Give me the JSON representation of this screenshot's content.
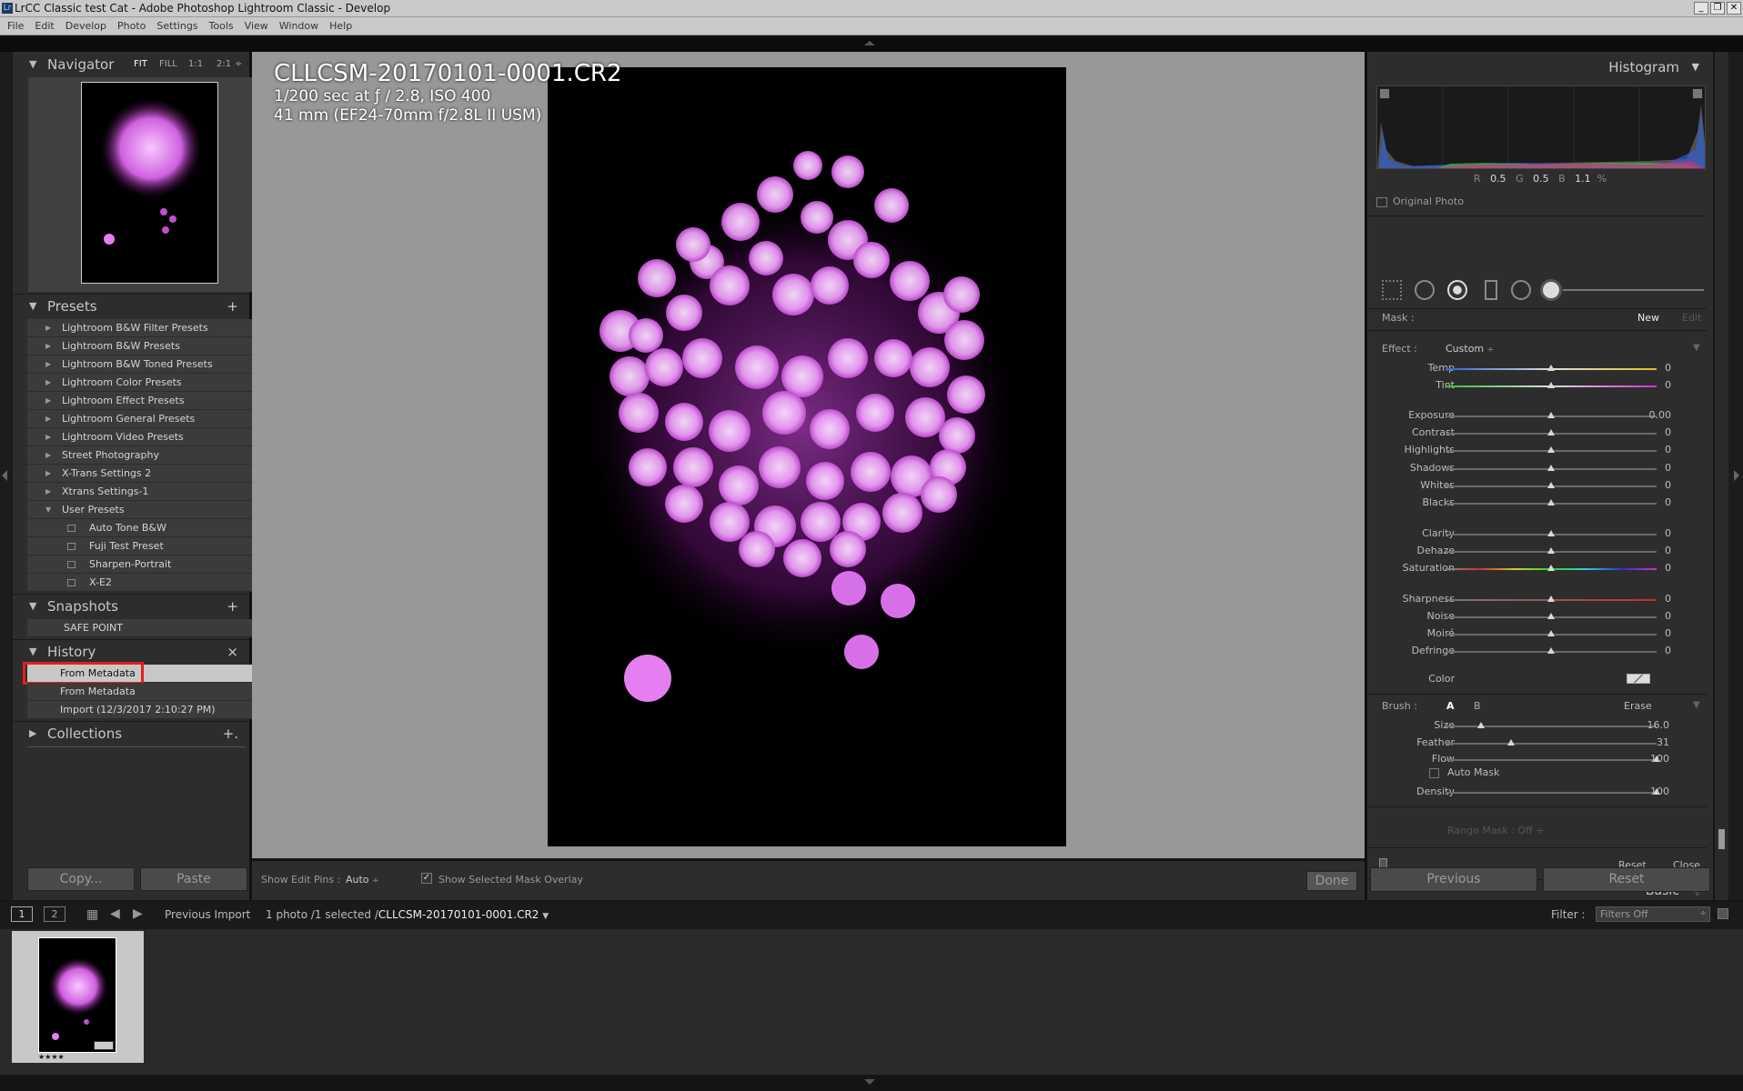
{
  "window": {
    "title": "LrCC Classic test Cat - Adobe Photoshop Lightroom Classic - Develop",
    "app_icon": "Lr"
  },
  "menu": [
    "File",
    "Edit",
    "Develop",
    "Photo",
    "Settings",
    "Tools",
    "View",
    "Window",
    "Help"
  ],
  "navigator": {
    "title": "Navigator",
    "zoom_options": [
      "FIT",
      "FILL",
      "1:1",
      "2:1"
    ],
    "zoom_arrow": "÷"
  },
  "presets": {
    "title": "Presets",
    "add": "+",
    "folders": [
      "Lightroom B&W Filter Presets",
      "Lightroom B&W Presets",
      "Lightroom B&W Toned Presets",
      "Lightroom Color Presets",
      "Lightroom Effect Presets",
      "Lightroom General Presets",
      "Lightroom Video Presets",
      "Street Photography",
      "X-Trans Settings 2",
      "Xtrans Settings-1",
      "User Presets"
    ],
    "user_presets": [
      "Auto Tone B&W",
      "Fuji Test Preset",
      "Sharpen-Portrait",
      "X-E2"
    ]
  },
  "snapshots": {
    "title": "Snapshots",
    "add": "+",
    "items": [
      "SAFE POINT"
    ]
  },
  "history": {
    "title": "History",
    "clear": "×",
    "items": [
      "From Metadata",
      "From Metadata",
      "Import (12/3/2017 2:10:27 PM)"
    ],
    "selected_index": 0
  },
  "collections": {
    "title": "Collections",
    "add": "+."
  },
  "left_buttons": {
    "copy": "Copy...",
    "paste": "Paste"
  },
  "photo": {
    "filename": "CLLCSM-20170101-0001.CR2",
    "exposure": "1/200 sec at ƒ / 2.8, ISO 400",
    "lens": "41 mm (EF24-70mm f/2.8L II USM)"
  },
  "toolbar": {
    "edit_pins_label": "Show Edit Pins :",
    "edit_pins_value": "Auto",
    "overlay_label": "Show Selected Mask Overlay",
    "overlay_checked": true,
    "done": "Done"
  },
  "histogram": {
    "title": "Histogram",
    "r_label": "R",
    "r": "0.5",
    "g_label": "G",
    "g": "0.5",
    "b_label": "B",
    "b": "1.1",
    "unit": "%",
    "original_photo": "Original Photo"
  },
  "mask": {
    "label": "Mask :",
    "new": "New",
    "edit": "Edit"
  },
  "effect": {
    "label": "Effect :",
    "value": "Custom",
    "arrow": "÷"
  },
  "sliders": [
    {
      "label": "Temp",
      "value": "0",
      "pos": 0.5
    },
    {
      "label": "Tint",
      "value": "0",
      "pos": 0.5
    },
    {
      "label": "Exposure",
      "value": "0.00",
      "pos": 0.5
    },
    {
      "label": "Contrast",
      "value": "0",
      "pos": 0.5
    },
    {
      "label": "Highlights",
      "value": "0",
      "pos": 0.5
    },
    {
      "label": "Shadows",
      "value": "0",
      "pos": 0.5
    },
    {
      "label": "Whites",
      "value": "0",
      "pos": 0.5
    },
    {
      "label": "Blacks",
      "value": "0",
      "pos": 0.5
    },
    {
      "label": "Clarity",
      "value": "0",
      "pos": 0.5
    },
    {
      "label": "Dehaze",
      "value": "0",
      "pos": 0.5
    },
    {
      "label": "Saturation",
      "value": "0",
      "pos": 0.5
    },
    {
      "label": "Sharpness",
      "value": "0",
      "pos": 0.5
    },
    {
      "label": "Noise",
      "value": "0",
      "pos": 0.5
    },
    {
      "label": "Moiré",
      "value": "0",
      "pos": 0.5
    },
    {
      "label": "Defringe",
      "value": "0",
      "pos": 0.5
    }
  ],
  "color_label": "Color",
  "brush": {
    "label": "Brush :",
    "a": "A",
    "b": "B",
    "erase": "Erase"
  },
  "brush_sliders": [
    {
      "label": "Size",
      "value": "16.0",
      "pos": 0.17
    },
    {
      "label": "Feather",
      "value": "31",
      "pos": 0.31
    },
    {
      "label": "Flow",
      "value": "100",
      "pos": 1.0
    }
  ],
  "auto_mask": "Auto Mask",
  "density": {
    "label": "Density",
    "value": "100",
    "pos": 1.0
  },
  "range_mask": {
    "label": "Range Mask :",
    "value": "Off",
    "arrow": "÷"
  },
  "mask_footer": {
    "reset": "Reset",
    "close": "Close"
  },
  "basic": {
    "title": "Basic"
  },
  "right_buttons": {
    "previous": "Previous",
    "reset": "Reset"
  },
  "filmbar": {
    "view1": "1",
    "view2": "2",
    "source": "Previous Import",
    "count": "1 photo /1 selected /",
    "filename": "CLLCSM-20170101-0001.CR2",
    "filter_label": "Filter :",
    "filter_value": "Filters Off"
  },
  "thumbnail": {
    "stars": "★★★★"
  },
  "colors": {
    "accent_red": "#e02020",
    "panel": "#2d2d2d",
    "center_bg": "#989898",
    "pink": "#e57ef0"
  }
}
